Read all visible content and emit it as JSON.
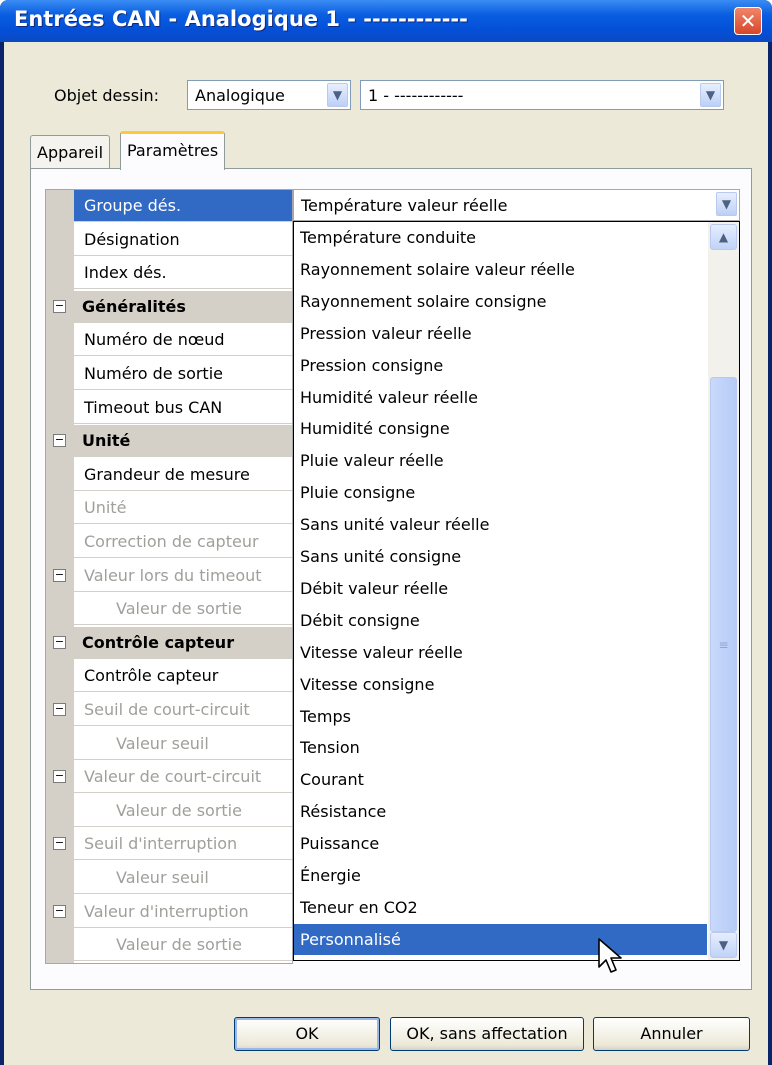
{
  "window": {
    "title": "Entrées CAN - Analogique 1 - ------------",
    "close_glyph": "✕"
  },
  "header": {
    "objet_label": "Objet dessin:",
    "objet_type": "Analogique",
    "objet_instance": "1 - ------------",
    "dropdown_glyph": "▼"
  },
  "tabs": [
    {
      "label": "Appareil",
      "active": false
    },
    {
      "label": "Paramètres",
      "active": true
    }
  ],
  "properties": [
    {
      "label": "Groupe dés.",
      "kind": "item",
      "state": "selected"
    },
    {
      "label": "Désignation",
      "kind": "item",
      "state": "normal"
    },
    {
      "label": "Index dés.",
      "kind": "item",
      "state": "normal"
    },
    {
      "label": "Généralités",
      "kind": "category",
      "state": "normal"
    },
    {
      "label": "Numéro de nœud",
      "kind": "item",
      "state": "normal"
    },
    {
      "label": "Numéro de sortie",
      "kind": "item",
      "state": "normal"
    },
    {
      "label": "Timeout bus CAN",
      "kind": "item",
      "state": "normal"
    },
    {
      "label": "Unité",
      "kind": "category",
      "state": "normal"
    },
    {
      "label": "Grandeur de mesure",
      "kind": "item",
      "state": "normal"
    },
    {
      "label": "Unité",
      "kind": "item",
      "state": "disabled"
    },
    {
      "label": "Correction de capteur",
      "kind": "item",
      "state": "disabled"
    },
    {
      "label": "Valeur lors du timeout",
      "kind": "group",
      "state": "disabled"
    },
    {
      "label": "Valeur de sortie",
      "kind": "sub",
      "state": "disabled"
    },
    {
      "label": "Contrôle capteur",
      "kind": "category",
      "state": "normal"
    },
    {
      "label": "Contrôle capteur",
      "kind": "item",
      "state": "normal"
    },
    {
      "label": "Seuil de court-circuit",
      "kind": "group",
      "state": "disabled"
    },
    {
      "label": "Valeur seuil",
      "kind": "sub",
      "state": "disabled"
    },
    {
      "label": "Valeur de court-circuit",
      "kind": "group",
      "state": "disabled"
    },
    {
      "label": "Valeur de sortie",
      "kind": "sub",
      "state": "disabled"
    },
    {
      "label": "Seuil d'interruption",
      "kind": "group",
      "state": "disabled"
    },
    {
      "label": "Valeur seuil",
      "kind": "sub",
      "state": "disabled"
    },
    {
      "label": "Valeur d'interruption",
      "kind": "group",
      "state": "disabled"
    },
    {
      "label": "Valeur de sortie",
      "kind": "sub",
      "state": "disabled"
    }
  ],
  "value_combo": {
    "value": "Température valeur réelle"
  },
  "options": [
    "Température conduite",
    "Rayonnement solaire valeur réelle",
    "Rayonnement solaire consigne",
    "Pression valeur réelle",
    "Pression consigne",
    "Humidité valeur réelle",
    "Humidité consigne",
    "Pluie valeur réelle",
    "Pluie consigne",
    "Sans unité valeur réelle",
    "Sans unité consigne",
    "Débit valeur réelle",
    "Débit consigne",
    "Vitesse valeur réelle",
    "Vitesse consigne",
    "Temps",
    "Tension",
    "Courant",
    "Résistance",
    "Puissance",
    "Énergie",
    "Teneur en CO2",
    "Personnalisé"
  ],
  "selected_option": "Personnalisé",
  "scrollbar": {
    "up_glyph": "▲",
    "down_glyph": "▼",
    "thumb_grip": "≡"
  },
  "buttons": {
    "ok": "OK",
    "ok_no_assign": "OK, sans affectation",
    "cancel": "Annuler"
  }
}
